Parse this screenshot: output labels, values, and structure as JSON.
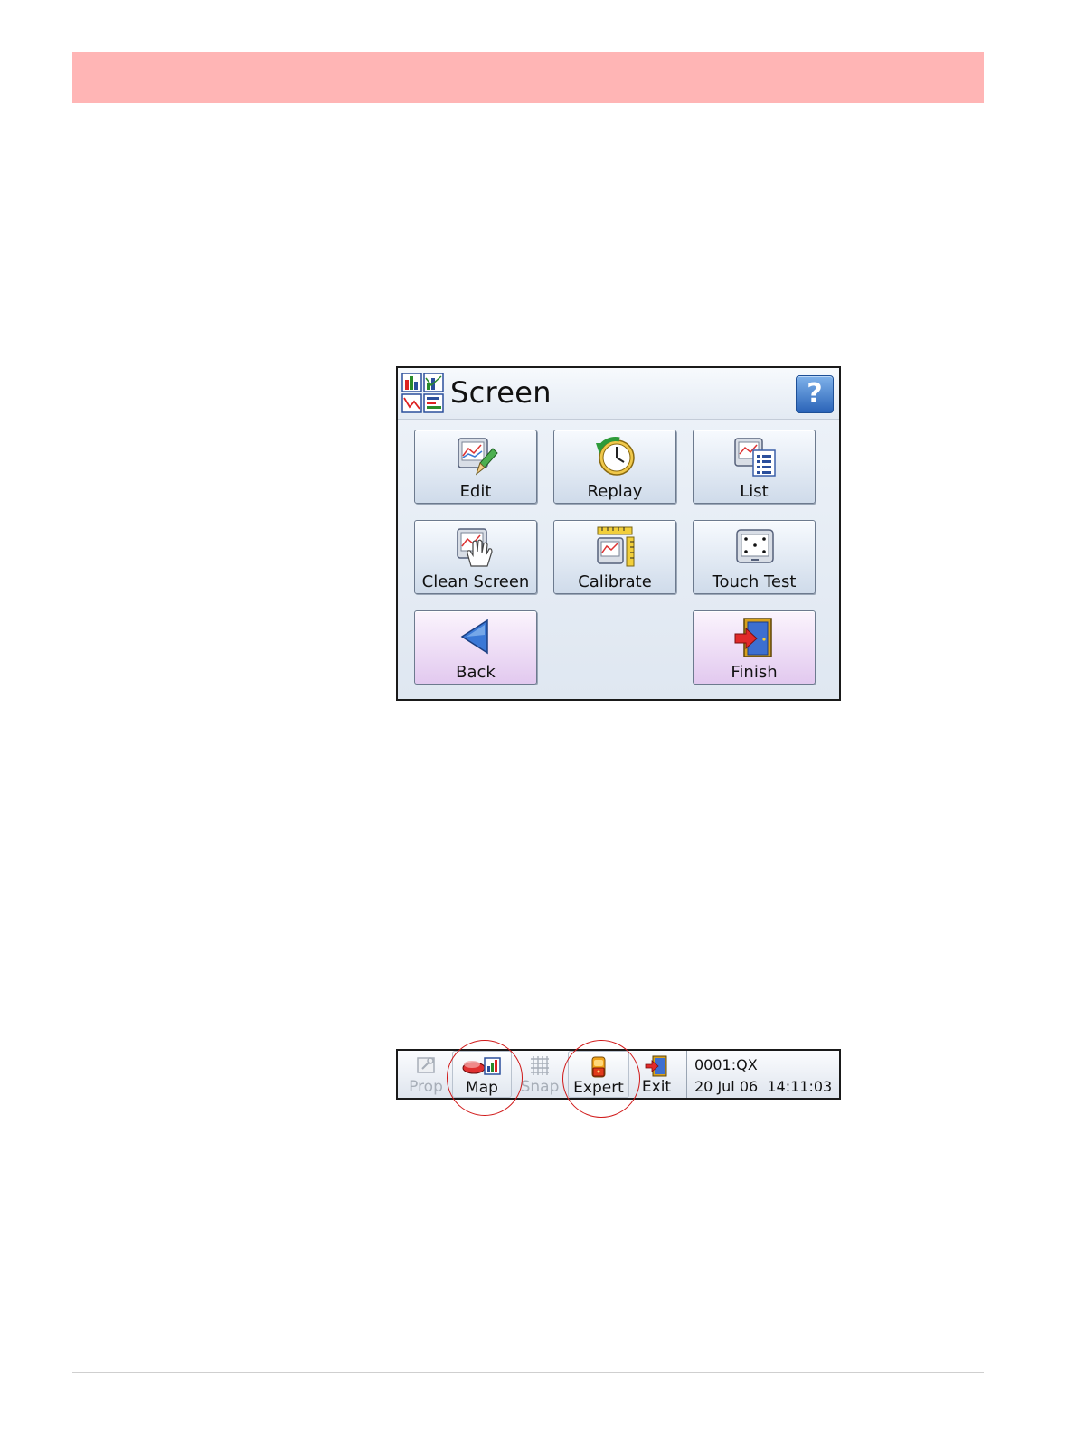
{
  "menu": {
    "title": "Screen",
    "help_label": "?",
    "buttons": [
      {
        "label": "Edit",
        "icon": "chart-edit-icon"
      },
      {
        "label": "Replay",
        "icon": "replay-clock-icon"
      },
      {
        "label": "List",
        "icon": "chart-list-icon"
      },
      {
        "label": "Clean Screen",
        "icon": "hand-wipe-icon"
      },
      {
        "label": "Calibrate",
        "icon": "calibrate-ruler-icon"
      },
      {
        "label": "Touch Test",
        "icon": "touch-points-icon"
      },
      {
        "label": "Back",
        "icon": "back-arrow-icon"
      },
      {
        "label": "Finish",
        "icon": "exit-door-icon"
      }
    ]
  },
  "statusbar": {
    "prop": "Prop",
    "map": "Map",
    "snap": "Snap",
    "expert": "Expert",
    "exit": "Exit",
    "device_id": "0001:QX",
    "datetime": "20 Jul 06  14:11:03"
  },
  "colors": {
    "banner": "#ffb5b5",
    "highlight_ring": "#d01818",
    "finish_back_tile": "#e2c9ef"
  }
}
